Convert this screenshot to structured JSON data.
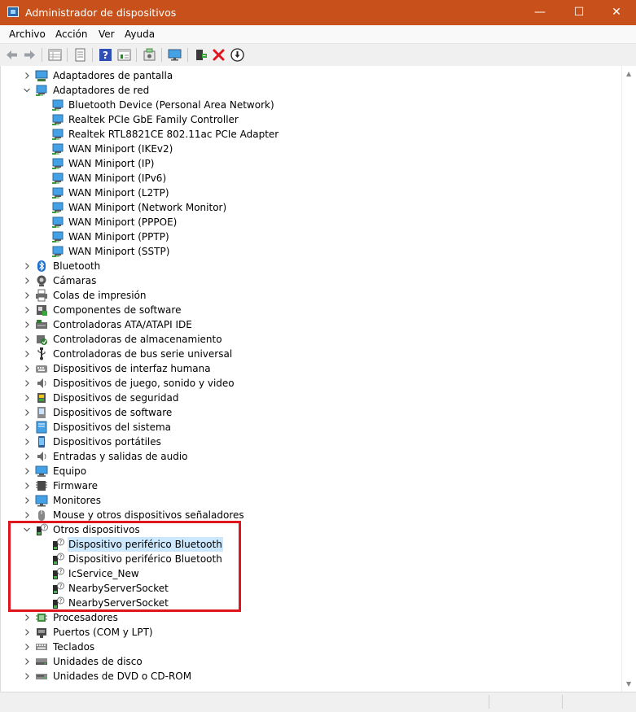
{
  "window": {
    "title": "Administrador de dispositivos"
  },
  "menu": [
    "Archivo",
    "Acción",
    "Ver",
    "Ayuda"
  ],
  "toolbar": {
    "buttons": [
      "back-icon",
      "forward-icon",
      "properties-grid-icon",
      "properties-sheet-icon",
      "help-icon",
      "update-driver-icon",
      "scan-hardware-icon",
      "monitor-icon",
      "enable-device-icon",
      "uninstall-icon",
      "download-icon"
    ]
  },
  "colors": {
    "titlebar": "#c8511b",
    "selection": "#cce8ff",
    "highlight": "#e0161f"
  },
  "tree": [
    {
      "label": "Adaptadores de pantalla",
      "level": 0,
      "state": "collapsed",
      "icon": "display-adapter-icon"
    },
    {
      "label": "Adaptadores de red",
      "level": 0,
      "state": "expanded",
      "icon": "network-adapter-icon"
    },
    {
      "label": "Bluetooth Device (Personal Area Network)",
      "level": 1,
      "icon": "network-adapter-icon"
    },
    {
      "label": "Realtek PCIe GbE Family Controller",
      "level": 1,
      "icon": "network-adapter-icon"
    },
    {
      "label": "Realtek RTL8821CE 802.11ac PCIe Adapter",
      "level": 1,
      "icon": "network-adapter-icon"
    },
    {
      "label": "WAN Miniport (IKEv2)",
      "level": 1,
      "icon": "network-adapter-icon"
    },
    {
      "label": "WAN Miniport (IP)",
      "level": 1,
      "icon": "network-adapter-icon"
    },
    {
      "label": "WAN Miniport (IPv6)",
      "level": 1,
      "icon": "network-adapter-icon"
    },
    {
      "label": "WAN Miniport (L2TP)",
      "level": 1,
      "icon": "network-adapter-icon"
    },
    {
      "label": "WAN Miniport (Network Monitor)",
      "level": 1,
      "icon": "network-adapter-icon"
    },
    {
      "label": "WAN Miniport (PPPOE)",
      "level": 1,
      "icon": "network-adapter-icon"
    },
    {
      "label": "WAN Miniport (PPTP)",
      "level": 1,
      "icon": "network-adapter-icon"
    },
    {
      "label": "WAN Miniport (SSTP)",
      "level": 1,
      "icon": "network-adapter-icon"
    },
    {
      "label": "Bluetooth",
      "level": 0,
      "state": "collapsed",
      "icon": "bluetooth-icon"
    },
    {
      "label": "Cámaras",
      "level": 0,
      "state": "collapsed",
      "icon": "camera-icon"
    },
    {
      "label": "Colas de impresión",
      "level": 0,
      "state": "collapsed",
      "icon": "printer-icon"
    },
    {
      "label": "Componentes de software",
      "level": 0,
      "state": "collapsed",
      "icon": "software-component-icon"
    },
    {
      "label": "Controladoras ATA/ATAPI IDE",
      "level": 0,
      "state": "collapsed",
      "icon": "ide-controller-icon"
    },
    {
      "label": "Controladoras de almacenamiento",
      "level": 0,
      "state": "collapsed",
      "icon": "storage-controller-icon"
    },
    {
      "label": "Controladoras de bus serie universal",
      "level": 0,
      "state": "collapsed",
      "icon": "usb-icon"
    },
    {
      "label": "Dispositivos de interfaz humana",
      "level": 0,
      "state": "collapsed",
      "icon": "hid-icon"
    },
    {
      "label": "Dispositivos de juego, sonido y video",
      "level": 0,
      "state": "collapsed",
      "icon": "speaker-icon"
    },
    {
      "label": "Dispositivos de seguridad",
      "level": 0,
      "state": "collapsed",
      "icon": "security-device-icon"
    },
    {
      "label": "Dispositivos de software",
      "level": 0,
      "state": "collapsed",
      "icon": "software-device-icon"
    },
    {
      "label": "Dispositivos del sistema",
      "level": 0,
      "state": "collapsed",
      "icon": "system-device-icon"
    },
    {
      "label": "Dispositivos portátiles",
      "level": 0,
      "state": "collapsed",
      "icon": "portable-device-icon"
    },
    {
      "label": "Entradas y salidas de audio",
      "level": 0,
      "state": "collapsed",
      "icon": "audio-io-icon"
    },
    {
      "label": "Equipo",
      "level": 0,
      "state": "collapsed",
      "icon": "computer-icon"
    },
    {
      "label": "Firmware",
      "level": 0,
      "state": "collapsed",
      "icon": "firmware-icon"
    },
    {
      "label": "Monitores",
      "level": 0,
      "state": "collapsed",
      "icon": "monitor-icon"
    },
    {
      "label": "Mouse y otros dispositivos señaladores",
      "level": 0,
      "state": "collapsed",
      "icon": "mouse-icon"
    },
    {
      "label": "Otros dispositivos",
      "level": 0,
      "state": "expanded",
      "icon": "unknown-device-icon"
    },
    {
      "label": "Dispositivo periférico Bluetooth",
      "level": 1,
      "icon": "unknown-device-icon",
      "selected": true
    },
    {
      "label": "Dispositivo periférico Bluetooth",
      "level": 1,
      "icon": "unknown-device-icon"
    },
    {
      "label": "IcService_New",
      "level": 1,
      "icon": "unknown-device-icon"
    },
    {
      "label": "NearbyServerSocket",
      "level": 1,
      "icon": "unknown-device-icon"
    },
    {
      "label": "NearbyServerSocket",
      "level": 1,
      "icon": "unknown-device-icon"
    },
    {
      "label": "Procesadores",
      "level": 0,
      "state": "collapsed",
      "icon": "processor-icon"
    },
    {
      "label": "Puertos (COM y LPT)",
      "level": 0,
      "state": "collapsed",
      "icon": "port-icon"
    },
    {
      "label": "Teclados",
      "level": 0,
      "state": "collapsed",
      "icon": "keyboard-icon"
    },
    {
      "label": "Unidades de disco",
      "level": 0,
      "state": "collapsed",
      "icon": "disk-drive-icon"
    },
    {
      "label": "Unidades de DVD o CD-ROM",
      "level": 0,
      "state": "collapsed",
      "icon": "dvd-drive-icon"
    }
  ]
}
